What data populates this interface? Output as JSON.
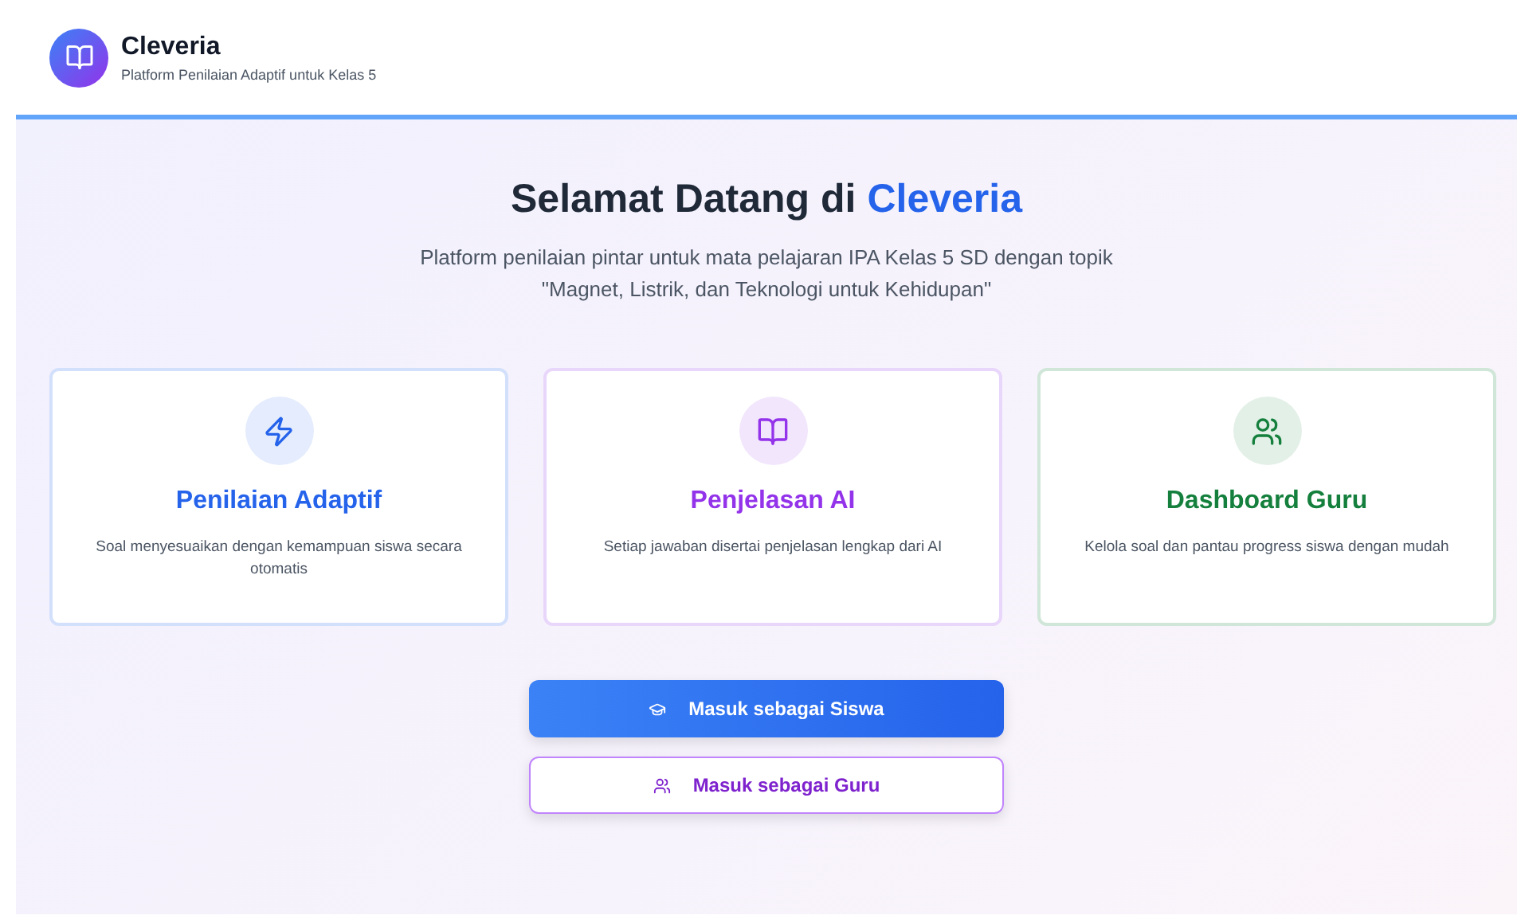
{
  "header": {
    "app_name": "Cleveria",
    "tagline": "Platform Penilaian Adaptif untuk Kelas 5"
  },
  "hero": {
    "title": "Selamat Datang di",
    "title_highlight": "Cleveria",
    "subtitle": "Platform penilaian pintar untuk mata pelajaran IPA Kelas 5 SD dengan topik \"Magnet, Listrik, dan Teknologi untuk Kehidupan\""
  },
  "features": [
    {
      "kind": "zap",
      "title": "Penilaian Adaptif",
      "description": "Soal menyesuaikan dengan kemampuan siswa secara otomatis",
      "color": "#2563eb"
    },
    {
      "kind": "book",
      "title": "Penjelasan AI",
      "description": "Setiap jawaban disertai penjelasan lengkap dari AI",
      "color": "#9333ea"
    },
    {
      "kind": "users",
      "title": "Dashboard Guru",
      "description": "Kelola soal dan pantau progress siswa dengan mudah",
      "color": "#15803d"
    }
  ],
  "buttons": [
    {
      "kind": "primary",
      "label": "Masuk sebagai Siswa"
    },
    {
      "kind": "outline",
      "label": "Masuk sebagai Guru"
    }
  ]
}
